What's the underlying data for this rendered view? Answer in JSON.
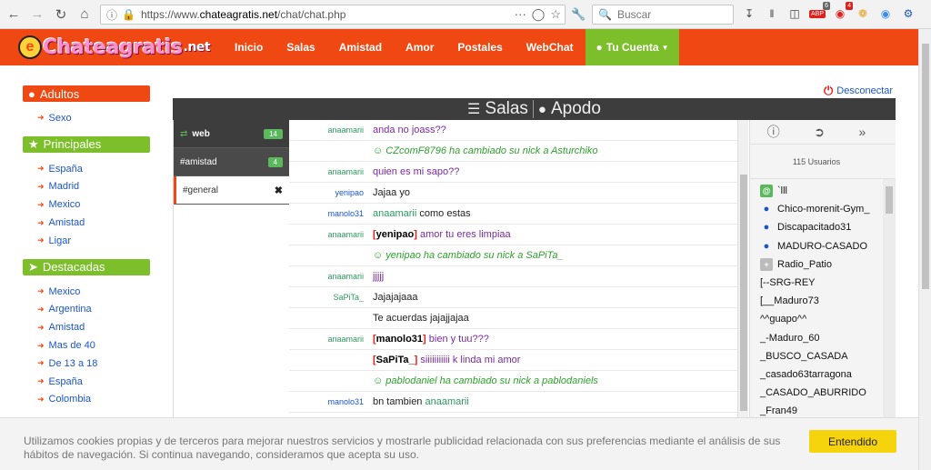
{
  "browser": {
    "url_prefix": "https://www.",
    "url_domain": "chateagratis.net",
    "url_path": "/chat/chat.php",
    "search_placeholder": "Buscar",
    "badges": {
      "adblock": "6",
      "ext": "4"
    }
  },
  "site": {
    "logo_main": "Chateagratis",
    "logo_suffix": ".net",
    "nav": [
      "Inicio",
      "Salas",
      "Amistad",
      "Amor",
      "Postales",
      "WebChat"
    ],
    "account": "Tu Cuenta",
    "disconnect": "Desconectar"
  },
  "sidebar": {
    "sections": [
      {
        "title": "Adultos",
        "color": "red",
        "items": [
          "Sexo"
        ]
      },
      {
        "title": "Principales",
        "color": "green",
        "items": [
          "España",
          "Madrid",
          "Mexico",
          "Amistad",
          "Ligar"
        ]
      },
      {
        "title": "Destacadas",
        "color": "green",
        "items": [
          "Mexico",
          "Argentina",
          "Amistad",
          "Mas de 40",
          "De 13 a 18",
          "España",
          "Colombia"
        ]
      }
    ]
  },
  "chat": {
    "tab_rooms": "Salas",
    "tab_nick": "Apodo",
    "rooms": [
      {
        "name": "web",
        "count": "14"
      },
      {
        "name": "#amistad",
        "count": "4"
      },
      {
        "name": "#general",
        "count": ""
      }
    ],
    "users_count_label": "115 Usuarios",
    "messages": [
      {
        "nick": "anaamarii",
        "text": "anda no joass??"
      },
      {
        "nick": "",
        "text": "CZcomF8796 ha cambiado su nick a Asturchiko"
      },
      {
        "nick": "anaamarii",
        "text": "quien es mi sapo??"
      },
      {
        "nick": "yenipao",
        "text": "Jajaa yo"
      },
      {
        "nick": "manolo31",
        "text_mention": "anaamarii",
        "text": "como estas"
      },
      {
        "nick": "anaamarii",
        "text_user": "yenipao",
        "text": "amor tu eres limpiaa"
      },
      {
        "nick": "",
        "text": "yenipao ha cambiado su nick a SaPiTa_"
      },
      {
        "nick": "anaamarii",
        "text": "jjjjj"
      },
      {
        "nick": "SaPiTa_",
        "text": "Jajajajaaa"
      },
      {
        "nick": "",
        "text": "Te acuerdas jajajjajaa"
      },
      {
        "nick": "anaamarii",
        "text_user": "manolo31",
        "text": "bien y tuu???"
      },
      {
        "nick": "",
        "text_user": "SaPiTa_",
        "text": "siiiiiiiiiii k linda mi amor"
      },
      {
        "nick": "",
        "text": "pablodaniel ha cambiado su nick a pablodaniels"
      },
      {
        "nick": "manolo31",
        "text": "bn tambien",
        "text_tail": "anaamarii"
      }
    ],
    "users": [
      {
        "icon": "at",
        "name": "`lll"
      },
      {
        "icon": "person",
        "name": "Chico-morenit-Gym_"
      },
      {
        "icon": "person",
        "name": "Discapacitado31"
      },
      {
        "icon": "person",
        "name": "MADURO-CASADO"
      },
      {
        "icon": "plus",
        "name": "Radio_Patio"
      },
      {
        "icon": "",
        "name": "[--SRG-REY"
      },
      {
        "icon": "",
        "name": "[__Maduro73"
      },
      {
        "icon": "",
        "name": "^^guapo^^"
      },
      {
        "icon": "",
        "name": "_-Maduro_60"
      },
      {
        "icon": "",
        "name": "_BUSCO_CASADA"
      },
      {
        "icon": "",
        "name": "_casado63tarragona"
      },
      {
        "icon": "",
        "name": "_CASADO_ABURRIDO"
      },
      {
        "icon": "",
        "name": "_Fran49"
      }
    ]
  },
  "cookie": {
    "text": "Utilizamos cookies propias y de terceros para mejorar nuestros servicios y mostrarle publicidad relacionada con sus preferencias mediante el análisis de sus hábitos de navegación. Si continua navegando, consideramos que acepta su uso.",
    "button": "Entendido"
  },
  "colors": {
    "brand": "#f04812",
    "green": "#7cbf2a",
    "link": "#1a55c8"
  }
}
